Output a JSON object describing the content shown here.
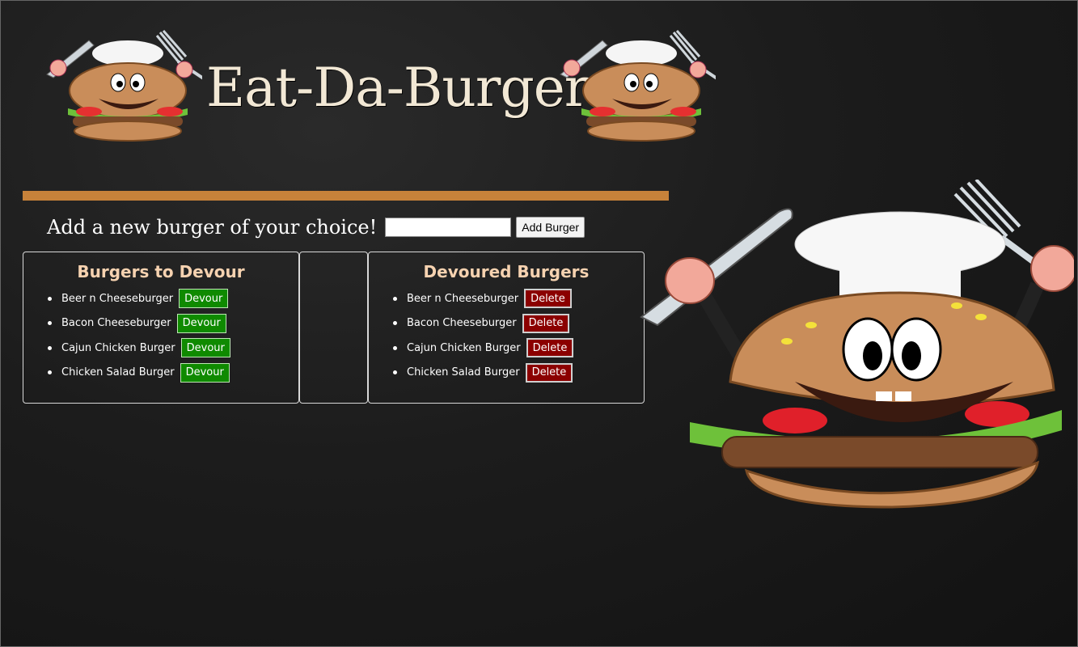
{
  "app": {
    "title": "Eat-Da-Burger"
  },
  "add_form": {
    "label": "Add a new burger of your choice!",
    "input_value": "",
    "button_label": "Add Burger"
  },
  "to_devour": {
    "heading": "Burgers to Devour",
    "items": [
      {
        "name": "Beer n Cheeseburger",
        "action": "Devour"
      },
      {
        "name": "Bacon Cheeseburger",
        "action": "Devour"
      },
      {
        "name": "Cajun Chicken Burger",
        "action": "Devour"
      },
      {
        "name": "Chicken Salad Burger",
        "action": "Devour"
      }
    ]
  },
  "devoured": {
    "heading": "Devoured Burgers",
    "items": [
      {
        "name": "Beer n Cheeseburger",
        "action": "Delete"
      },
      {
        "name": "Bacon Cheeseburger",
        "action": "Delete"
      },
      {
        "name": "Cajun Chicken Burger",
        "action": "Delete"
      },
      {
        "name": "Chicken Salad Burger",
        "action": "Delete"
      }
    ]
  },
  "colors": {
    "accent_bar": "#c7823a",
    "devour_button": "#0f8a00",
    "delete_button": "#8b0000",
    "panel_heading": "#f6d2b0"
  },
  "icons": [
    "burger-mascot-icon",
    "fork-icon",
    "knife-icon",
    "chef-hat-icon"
  ]
}
